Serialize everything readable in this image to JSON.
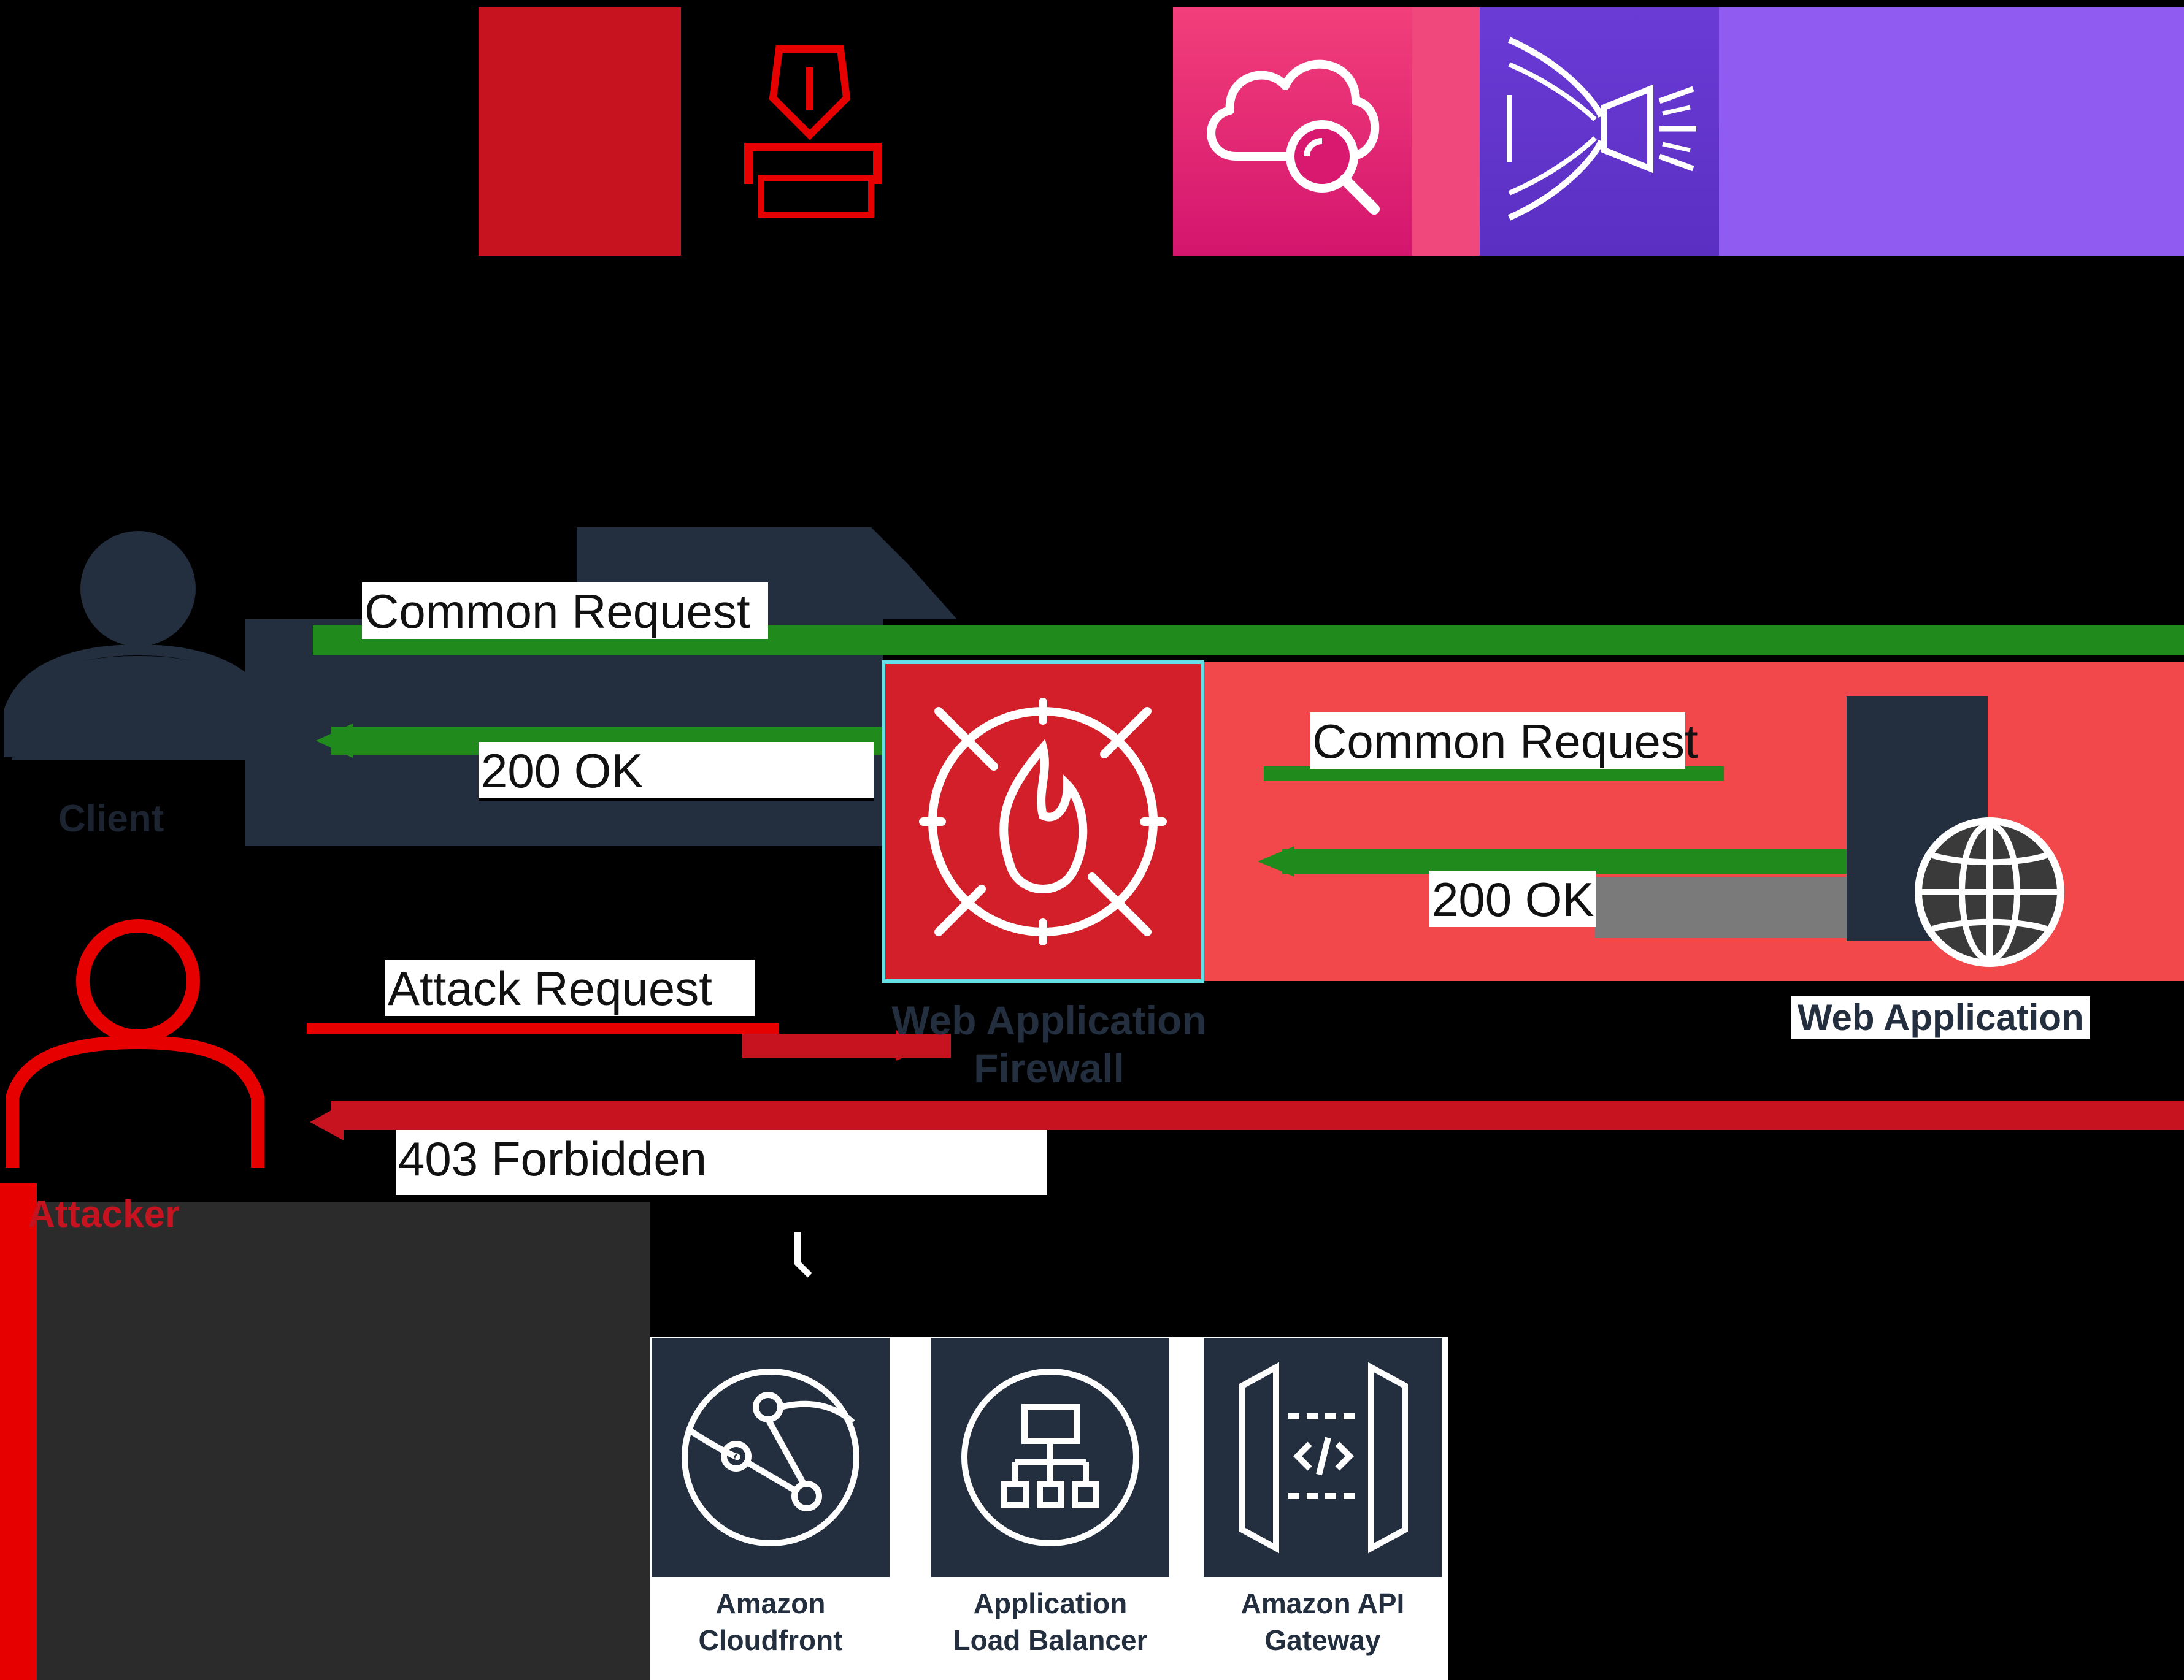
{
  "diagram": {
    "actors": {
      "client": {
        "name": "Client"
      },
      "attacker": {
        "name": "Attacker"
      }
    },
    "waf": {
      "title_line1": "Web Application",
      "title_line2": "Firewall"
    },
    "server": {
      "name": "Web Application"
    },
    "flows": {
      "client_request": "Common Request",
      "client_response": "200 OK",
      "server_request": "Common Request",
      "server_response": "200 OK",
      "attack_request": "Attack Request",
      "attack_response": "403 Forbidden"
    },
    "services": [
      {
        "line1": "Amazon",
        "line2": "Cloudfront"
      },
      {
        "line1": "Application",
        "line2": "Load Balancer"
      },
      {
        "line1": "Amazon API",
        "line2": "Gateway"
      }
    ],
    "colors": {
      "red": "#c7131f",
      "bright_red": "#e60000",
      "salmon": "#f2484b",
      "green": "#218a1c",
      "navy": "#232f3e",
      "pink": "#e7157b",
      "purple": "#8c4fff"
    }
  }
}
